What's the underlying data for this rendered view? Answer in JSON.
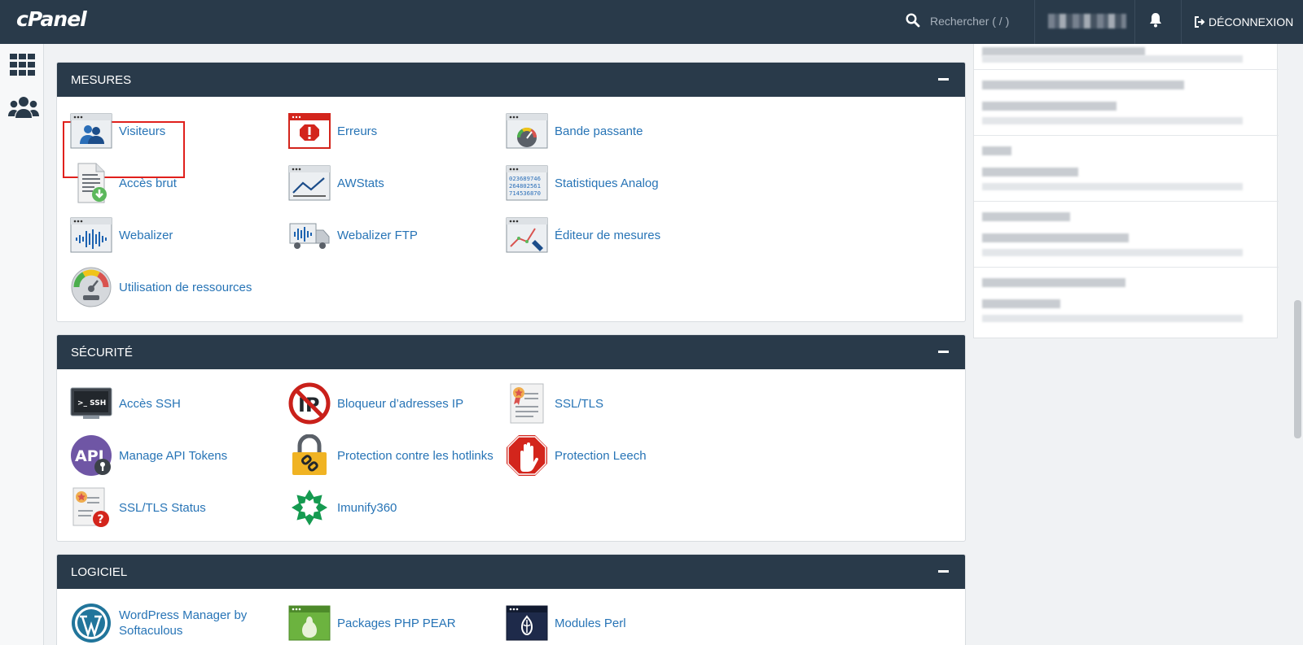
{
  "app": {
    "logo": "cPanel"
  },
  "topbar": {
    "search_placeholder": "Rechercher ( / )",
    "logout_label": "DÉCONNEXION"
  },
  "sections": {
    "mesures": {
      "title": "MESURES",
      "items": [
        {
          "label": "Visiteurs",
          "icon": "visitors-icon"
        },
        {
          "label": "Erreurs",
          "icon": "errors-icon"
        },
        {
          "label": "Bande passante",
          "icon": "bandwidth-icon"
        },
        {
          "label": "Accès brut",
          "icon": "raw-access-icon"
        },
        {
          "label": "AWStats",
          "icon": "awstats-icon"
        },
        {
          "label": "Statistiques Analog",
          "icon": "analog-stats-icon"
        },
        {
          "label": "Webalizer",
          "icon": "webalizer-icon"
        },
        {
          "label": "Webalizer FTP",
          "icon": "webalizer-ftp-icon"
        },
        {
          "label": "Éditeur de mesures",
          "icon": "metrics-editor-icon"
        },
        {
          "label": "Utilisation de ressources",
          "icon": "resource-usage-icon"
        }
      ]
    },
    "securite": {
      "title": "SÉCURITÉ",
      "items": [
        {
          "label": "Accès SSH",
          "icon": "ssh-icon"
        },
        {
          "label": "Bloqueur d’adresses IP",
          "icon": "ip-blocker-icon"
        },
        {
          "label": "SSL/TLS",
          "icon": "ssl-tls-icon"
        },
        {
          "label": "Manage API Tokens",
          "icon": "api-tokens-icon"
        },
        {
          "label": "Protection contre les hotlinks",
          "icon": "hotlink-protection-icon"
        },
        {
          "label": "Protection Leech",
          "icon": "leech-protection-icon"
        },
        {
          "label": "SSL/TLS Status",
          "icon": "ssl-status-icon"
        },
        {
          "label": "Imunify360",
          "icon": "imunify360-icon"
        }
      ]
    },
    "logiciel": {
      "title": "LOGICIEL",
      "items": [
        {
          "label": "WordPress Manager by Softaculous",
          "icon": "wordpress-icon"
        },
        {
          "label": "Packages PHP PEAR",
          "icon": "php-pear-icon"
        },
        {
          "label": "Modules Perl",
          "icon": "perl-modules-icon"
        }
      ]
    }
  },
  "icon_text": {
    "ssh": ">_ SSH",
    "api": "API",
    "analog_lines": [
      "023689746",
      "264802561",
      "714536870"
    ]
  },
  "colors": {
    "header_bg": "#293a4a",
    "link": "#2774b6",
    "highlight": "#e0201c"
  }
}
